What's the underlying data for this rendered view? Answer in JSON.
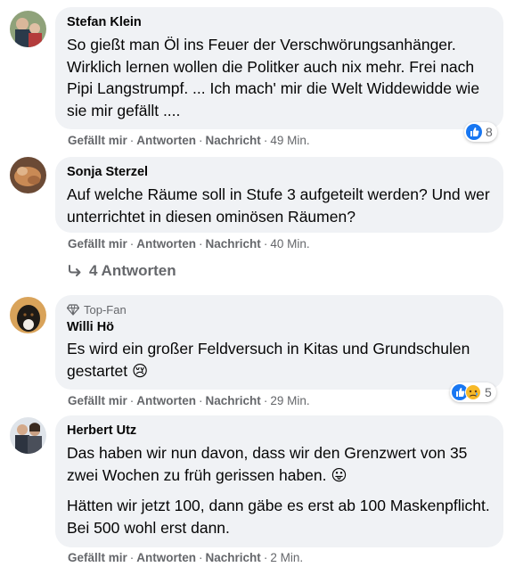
{
  "comments": [
    {
      "author": "Stefan Klein",
      "text": "So gießt man Öl ins Feuer der Verschwörungsanhänger. Wirklich lernen wollen die Politker auch nix mehr. Frei nach Pipi Langstrumpf. ... Ich mach' mir die Welt Widdewidde wie sie mir gefällt ....",
      "like": "Gefällt mir",
      "reply": "Antworten",
      "message": "Nachricht",
      "time": "49 Min.",
      "reactions": {
        "icons": [
          "like-icon"
        ],
        "count": "8"
      }
    },
    {
      "author": "Sonja Sterzel",
      "text": "Auf welche Räume soll in Stufe 3 aufgeteilt werden? Und wer unterrichtet in diesen ominösen Räumen?",
      "like": "Gefällt mir",
      "reply": "Antworten",
      "message": "Nachricht",
      "time": "40 Min.",
      "replies": "4 Antworten"
    },
    {
      "badge": "Top-Fan",
      "author": "Willi Hö",
      "text": "Es wird ein großer Feldversuch in Kitas und Grundschulen gestartet 😢",
      "like": "Gefällt mir",
      "reply": "Antworten",
      "message": "Nachricht",
      "time": "29 Min.",
      "reactions": {
        "icons": [
          "like-icon",
          "sad-icon"
        ],
        "count": "5"
      }
    },
    {
      "author": "Herbert Utz",
      "text": "Das haben wir nun davon, dass wir den Grenzwert von 35 zwei Wochen zu früh gerissen haben. 😛",
      "text2": "Hätten wir jetzt 100, dann gäbe es erst ab 100 Maskenpflicht. Bei 500 wohl erst dann.",
      "like": "Gefällt mir",
      "reply": "Antworten",
      "message": "Nachricht",
      "time": "2 Min."
    }
  ],
  "colors": {
    "bubble": "#f0f2f5",
    "meta": "#65676b",
    "like_blue": "#1877f2",
    "sad_yellow": "#f7b928"
  }
}
